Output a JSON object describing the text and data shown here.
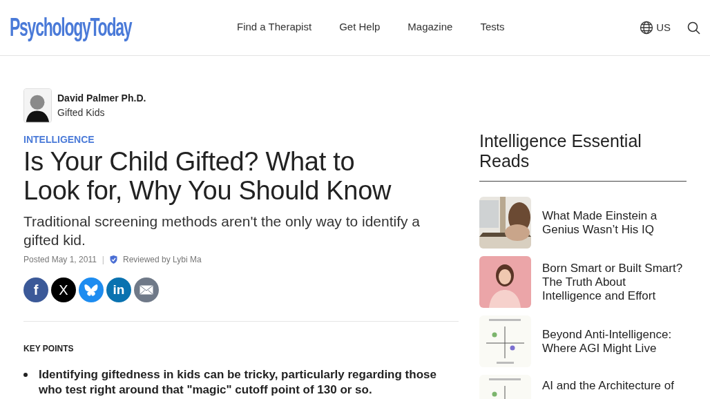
{
  "header": {
    "logo": "PsychologyToday",
    "nav": [
      {
        "label": "Find a Therapist"
      },
      {
        "label": "Get Help"
      },
      {
        "label": "Magazine"
      },
      {
        "label": "Tests"
      }
    ],
    "region": "US"
  },
  "article": {
    "author": {
      "name": "David Palmer Ph.D.",
      "blog": "Gifted Kids"
    },
    "category": "INTELLIGENCE",
    "title": "Is Your Child Gifted? What to Look for, Why You Should Know",
    "subtitle": "Traditional screening methods aren't the only way to identify a gifted kid.",
    "posted": "Posted May 1, 2011",
    "separator": "|",
    "reviewed": "Reviewed by Lybi Ma",
    "share": [
      {
        "kind": "facebook",
        "glyph": "f"
      },
      {
        "kind": "x",
        "glyph": "X"
      },
      {
        "kind": "bluesky"
      },
      {
        "kind": "linkedin",
        "glyph": "in"
      },
      {
        "kind": "email"
      }
    ],
    "key_points_heading": "KEY POINTS",
    "key_points": [
      "Identifying giftedness in kids can be tricky, particularly regarding those who test right around that \"magic\" cutoff point of 130 or so."
    ]
  },
  "sidebar": {
    "heading": "Intelligence Essential Reads",
    "items": [
      {
        "title": "What Made Einstein a Genius Wasn’t His IQ",
        "kind": "picture"
      },
      {
        "title": "Born Smart or Built Smart? The Truth About Intelligence and Effort",
        "kind": "picture"
      },
      {
        "title": "Beyond Anti-Intelligence: Where AGI Might Live",
        "kind": "picture"
      },
      {
        "title": "AI and the Architecture of",
        "kind": "picture"
      }
    ]
  }
}
